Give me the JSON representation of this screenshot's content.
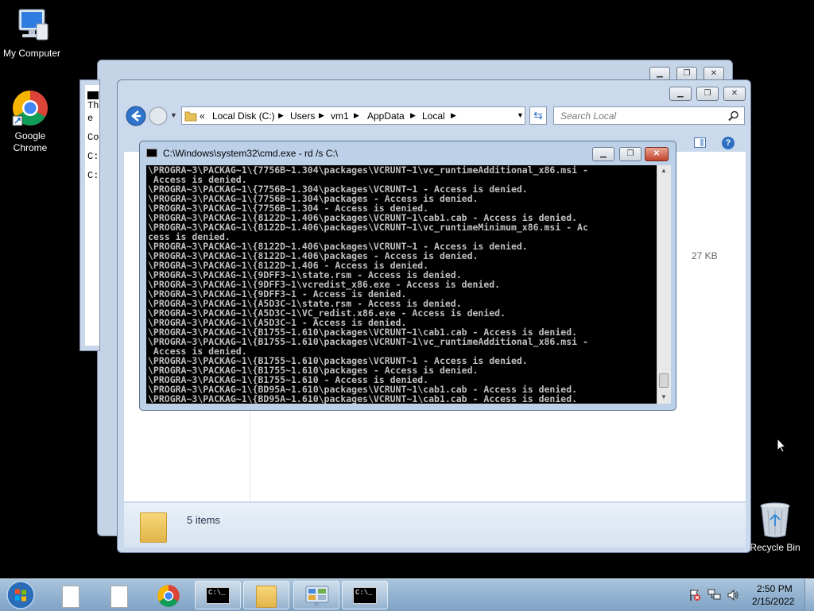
{
  "desktop": {
    "icons": [
      {
        "label": "My Computer",
        "icon": "computer-icon"
      },
      {
        "label": "Google Chrome",
        "icon": "chrome-icon"
      },
      {
        "label": "Recycle Bin",
        "icon": "recycle-bin-icon"
      }
    ]
  },
  "back_cmd": {
    "lines": [
      "Th",
      "e",
      "Co",
      "C:",
      "C:"
    ]
  },
  "explorer": {
    "breadcrumb": [
      "«",
      "Local Disk (C:)",
      "Users",
      "vm1",
      "AppData",
      "Local"
    ],
    "search_placeholder": "Search Local",
    "file_size": "27 KB",
    "status": "5 items"
  },
  "cmd": {
    "title": "C:\\Windows\\system32\\cmd.exe - rd  /s C:\\",
    "lines": [
      "\\PROGRA~3\\PACKAG~1\\{7756B~1.304\\packages\\VCRUNT~1\\vc_runtimeAdditional_x86.msi -",
      " Access is denied.",
      "\\PROGRA~3\\PACKAG~1\\{7756B~1.304\\packages\\VCRUNT~1 - Access is denied.",
      "\\PROGRA~3\\PACKAG~1\\{7756B~1.304\\packages - Access is denied.",
      "\\PROGRA~3\\PACKAG~1\\{7756B~1.304 - Access is denied.",
      "\\PROGRA~3\\PACKAG~1\\{8122D~1.406\\packages\\VCRUNT~1\\cab1.cab - Access is denied.",
      "\\PROGRA~3\\PACKAG~1\\{8122D~1.406\\packages\\VCRUNT~1\\vc_runtimeMinimum_x86.msi - Ac",
      "cess is denied.",
      "\\PROGRA~3\\PACKAG~1\\{8122D~1.406\\packages\\VCRUNT~1 - Access is denied.",
      "\\PROGRA~3\\PACKAG~1\\{8122D~1.406\\packages - Access is denied.",
      "\\PROGRA~3\\PACKAG~1\\{8122D~1.406 - Access is denied.",
      "\\PROGRA~3\\PACKAG~1\\{9DFF3~1\\state.rsm - Access is denied.",
      "\\PROGRA~3\\PACKAG~1\\{9DFF3~1\\vcredist_x86.exe - Access is denied.",
      "\\PROGRA~3\\PACKAG~1\\{9DFF3~1 - Access is denied.",
      "\\PROGRA~3\\PACKAG~1\\{A5D3C~1\\state.rsm - Access is denied.",
      "\\PROGRA~3\\PACKAG~1\\{A5D3C~1\\VC_redist.x86.exe - Access is denied.",
      "\\PROGRA~3\\PACKAG~1\\{A5D3C~1 - Access is denied.",
      "\\PROGRA~3\\PACKAG~1\\{B1755~1.610\\packages\\VCRUNT~1\\cab1.cab - Access is denied.",
      "\\PROGRA~3\\PACKAG~1\\{B1755~1.610\\packages\\VCRUNT~1\\vc_runtimeAdditional_x86.msi -",
      " Access is denied.",
      "\\PROGRA~3\\PACKAG~1\\{B1755~1.610\\packages\\VCRUNT~1 - Access is denied.",
      "\\PROGRA~3\\PACKAG~1\\{B1755~1.610\\packages - Access is denied.",
      "\\PROGRA~3\\PACKAG~1\\{B1755~1.610 - Access is denied.",
      "\\PROGRA~3\\PACKAG~1\\{BD95A~1.610\\packages\\VCRUNT~1\\cab1.cab - Access is denied.",
      "\\PROGRA~3\\PACKAG~1\\{BD95A~1.610\\packages\\VCRUNT~1\\cab1.cab - Access is denied."
    ]
  },
  "taskbar": {
    "time": "2:50 PM",
    "date": "2/15/2022"
  },
  "colors": {
    "console_text": "#c0c0c0",
    "taskbar": "#8fb0cf",
    "close_button": "#c1432b"
  }
}
